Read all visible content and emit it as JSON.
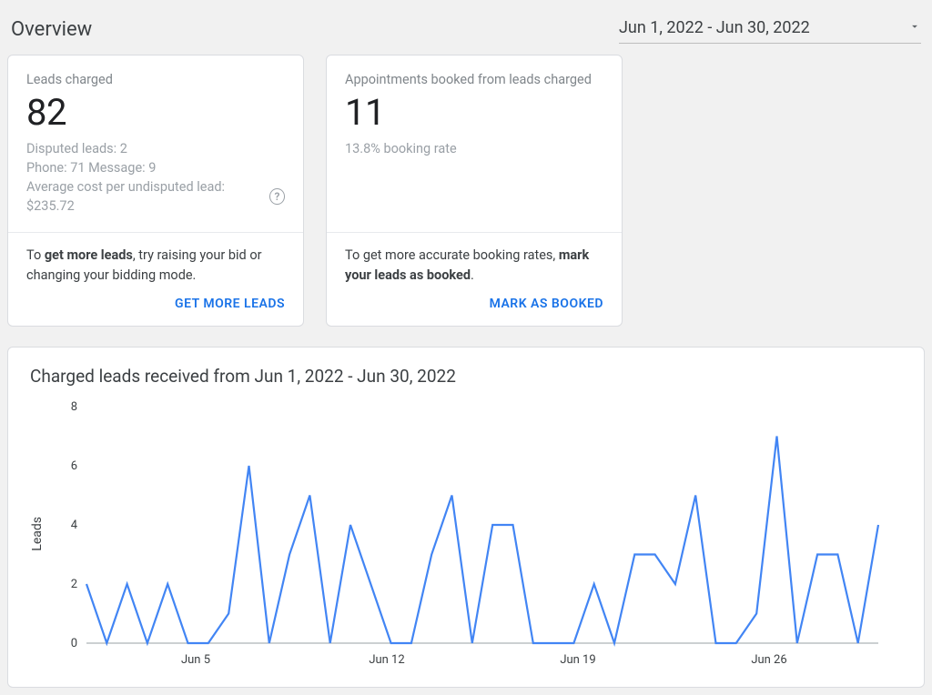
{
  "header": {
    "title": "Overview",
    "date_range": "Jun 1, 2022 - Jun 30, 2022"
  },
  "cards": {
    "leads": {
      "label": "Leads charged",
      "value": "82",
      "disputed": "Disputed leads: 2",
      "phone_msg": "Phone: 71   Message: 9",
      "avg_cost": "Average cost per undisputed lead: $235.72",
      "tip_pre": "To ",
      "tip_bold": "get more leads",
      "tip_post": ", try raising your bid or changing your bidding mode.",
      "cta": "GET MORE LEADS"
    },
    "appointments": {
      "label": "Appointments booked from leads charged",
      "value": "11",
      "rate": "13.8% booking rate",
      "tip_pre": "To get more accurate booking rates, ",
      "tip_bold": "mark your leads as booked",
      "tip_post": ".",
      "cta": "MARK AS BOOKED"
    }
  },
  "chart": {
    "title": "Charged leads received from Jun 1, 2022 - Jun 30, 2022",
    "ylabel": "Leads",
    "yticks": [
      "0",
      "2",
      "4",
      "6",
      "8"
    ],
    "xticks": [
      "Jun 5",
      "Jun 12",
      "Jun 19",
      "Jun 26"
    ]
  },
  "chart_data": {
    "type": "line",
    "title": "Charged leads received from Jun 1, 2022 - Jun 30, 2022",
    "xlabel": "",
    "ylabel": "Leads",
    "ylim": [
      0,
      8
    ],
    "x": [
      "Jun 1",
      "Jun 2",
      "Jun 3",
      "Jun 4",
      "Jun 5",
      "Jun 6",
      "Jun 7",
      "Jun 8",
      "Jun 9",
      "Jun 10",
      "Jun 11",
      "Jun 12",
      "Jun 13",
      "Jun 14",
      "Jun 15",
      "Jun 16",
      "Jun 17",
      "Jun 18",
      "Jun 19",
      "Jun 20",
      "Jun 21",
      "Jun 22",
      "Jun 23",
      "Jun 24",
      "Jun 25",
      "Jun 26",
      "Jun 27",
      "Jun 28",
      "Jun 29",
      "Jun 30"
    ],
    "values": [
      2,
      0,
      2,
      0,
      2,
      0,
      0,
      1,
      6,
      0,
      3,
      5,
      0,
      4,
      2,
      0,
      0,
      3,
      5,
      0,
      4,
      4,
      0,
      0,
      0,
      2,
      0,
      3,
      3,
      2,
      5,
      0,
      0,
      1,
      7,
      0,
      3,
      3,
      0,
      4
    ],
    "x_tick_labels": [
      "Jun 5",
      "Jun 12",
      "Jun 19",
      "Jun 26"
    ]
  }
}
